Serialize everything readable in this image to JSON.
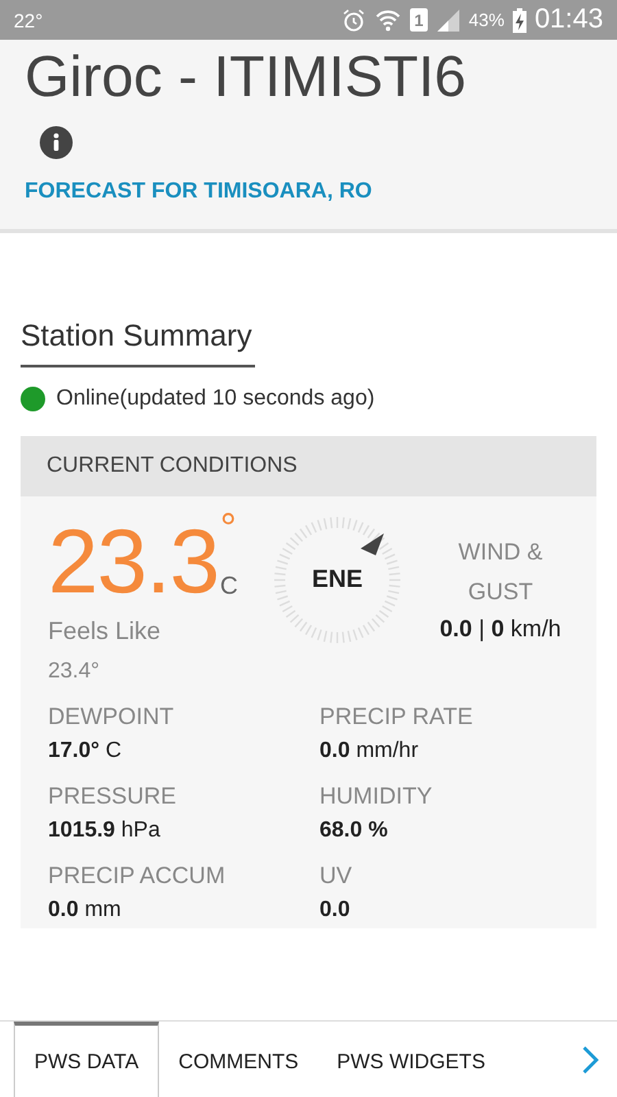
{
  "status_bar": {
    "temperature": "22°",
    "sim": "1",
    "battery": "43%",
    "time": "01:43"
  },
  "header": {
    "title": "Giroc - ITIMISTI6",
    "forecast_link": "FORECAST FOR TIMISOARA, RO"
  },
  "station_summary": {
    "heading": "Station Summary",
    "online": true,
    "status": "Online(updated 10 seconds ago)"
  },
  "current_conditions": {
    "heading": "CURRENT CONDITIONS",
    "temperature": {
      "value": "23.3",
      "degree": "°",
      "unit": "C"
    },
    "wind_direction": "ENE",
    "wind": {
      "label": "WIND & GUST",
      "reading": "**0.0** | **0** km/h"
    },
    "feels_like": {
      "label": "Feels Like",
      "value": "23.4°"
    },
    "metrics": [
      {
        "label": "DEWPOINT",
        "value": "**17.0°** C"
      },
      {
        "label": "PRECIP RATE",
        "value": "**0.0** mm/hr"
      },
      {
        "label": "PRESSURE",
        "value": "**1015.9** hPa"
      },
      {
        "label": "HUMIDITY",
        "value": "**68.0 %**"
      },
      {
        "label": "PRECIP ACCUM",
        "value": "**0.0** mm"
      },
      {
        "label": "UV",
        "value": "**0.0**"
      }
    ]
  },
  "tabs": [
    {
      "label": "PWS DATA",
      "selected": true
    },
    {
      "label": "COMMENTS",
      "selected": false
    },
    {
      "label": "PWS WIDGETS",
      "selected": false
    }
  ]
}
